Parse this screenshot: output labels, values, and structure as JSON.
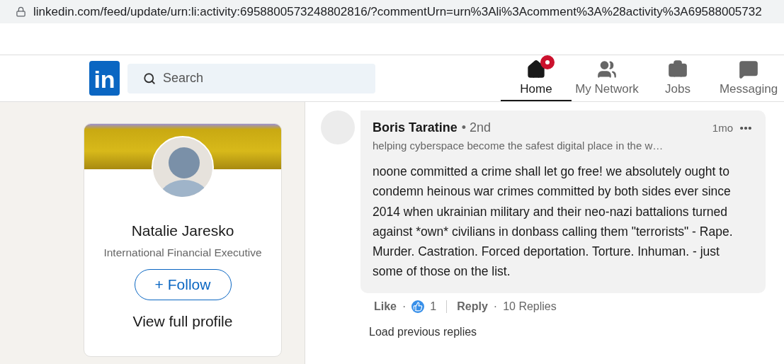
{
  "browser": {
    "url": "linkedin.com/feed/update/urn:li:activity:6958800573248802816/?commentUrn=urn%3Ali%3Acomment%3A%28activity%3A69588005732"
  },
  "header": {
    "logo": "in",
    "search": {
      "placeholder": "Search"
    },
    "nav": [
      {
        "kind": "home",
        "label": "Home",
        "selected": true,
        "notification": true
      },
      {
        "kind": "network",
        "label": "My Network",
        "selected": false,
        "notification": false
      },
      {
        "kind": "jobs",
        "label": "Jobs",
        "selected": false,
        "notification": false
      },
      {
        "kind": "messaging",
        "label": "Messaging",
        "selected": false,
        "notification": false
      }
    ]
  },
  "profile_card": {
    "name": "Natalie Jaresko",
    "headline": "International Financial Executive",
    "follow_icon": "+",
    "follow": "Follow",
    "view_profile": "View full profile"
  },
  "comment": {
    "author": "Boris Taratine",
    "degree": "• 2nd",
    "headline": "helping cyberspace become the safest digital place in the w…",
    "time": "1mo",
    "text": "noone committed a crime shall let go free! we absolutely ought to condemn heinous war crimes committed by both sides ever since 2014 when ukrainian military and their neo-nazi battalions turned against *own* civilians in donbass calling them \"terrorists\" - Rape. Murder. Castration. Forced deportation. Torture. Inhuman. - just some of those on the list.",
    "like": "Like",
    "sep1": "·",
    "reaction_count": "1",
    "reply": "Reply",
    "sep2": "·",
    "replies": "10 Replies"
  },
  "load_previous": "Load previous replies"
}
